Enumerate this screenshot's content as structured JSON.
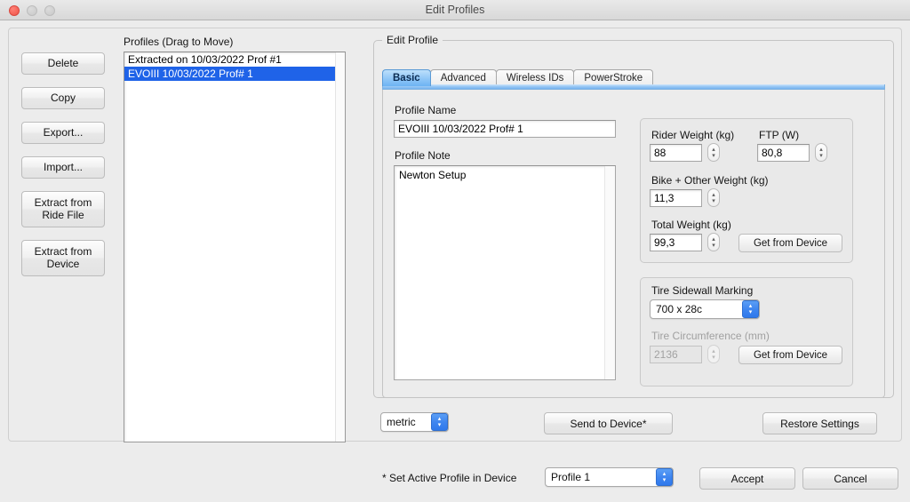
{
  "window": {
    "title": "Edit Profiles",
    "controls": {
      "close": "close-button",
      "minimize": "minimize-button",
      "maximize": "maximize-button"
    }
  },
  "sidebar": {
    "buttons": [
      {
        "label": "Delete",
        "lines": 1
      },
      {
        "label": "Copy",
        "lines": 1
      },
      {
        "label": "Export...",
        "lines": 1
      },
      {
        "label": "Import...",
        "lines": 1
      },
      {
        "label": "Extract from Ride File",
        "lines": 2
      },
      {
        "label": "Extract from Device",
        "lines": 2
      }
    ]
  },
  "profiles": {
    "label": "Profiles (Drag to Move)",
    "items": [
      {
        "text": "Extracted on 10/03/2022 Prof #1",
        "selected": false
      },
      {
        "text": "EVOIII 10/03/2022 Prof# 1",
        "selected": true
      }
    ],
    "selection_color": "#1f63e8"
  },
  "edit_profile": {
    "group_title": "Edit Profile",
    "tabs": [
      {
        "label": "Basic",
        "active": true
      },
      {
        "label": "Advanced",
        "active": false
      },
      {
        "label": "Wireless IDs",
        "active": false
      },
      {
        "label": "PowerStroke",
        "active": false
      }
    ],
    "tab_accent_color": "#74b2ef",
    "profile_name": {
      "label": "Profile Name",
      "value": "EVOIII 10/03/2022 Prof# 1"
    },
    "profile_note": {
      "label": "Profile Note",
      "value": "Newton Setup"
    },
    "weights": {
      "rider_weight": {
        "label": "Rider Weight (kg)",
        "value": "88"
      },
      "ftp": {
        "label": "FTP (W)",
        "value": "80,8"
      },
      "bike_other_weight": {
        "label": "Bike + Other Weight (kg)",
        "value": "11,3"
      },
      "total_weight": {
        "label": "Total Weight (kg)",
        "value": "99,3"
      },
      "get_from_device": "Get from Device"
    },
    "tire": {
      "sidewall_label": "Tire Sidewall Marking",
      "sidewall_value": "700 x 28c",
      "circumference_label": "Tire Circumference (mm)",
      "circumference_value": "2136",
      "circumference_disabled": true,
      "get_from_device": "Get from Device"
    },
    "units": {
      "value": "metric"
    },
    "send_to_device": "Send to Device*",
    "restore_settings": "Restore Settings"
  },
  "footer": {
    "active_profile_label": "* Set Active Profile in Device",
    "active_profile_value": "Profile 1",
    "accept": "Accept",
    "cancel": "Cancel"
  },
  "icons": {
    "chevron_up": "▴",
    "chevron_down": "▾"
  }
}
